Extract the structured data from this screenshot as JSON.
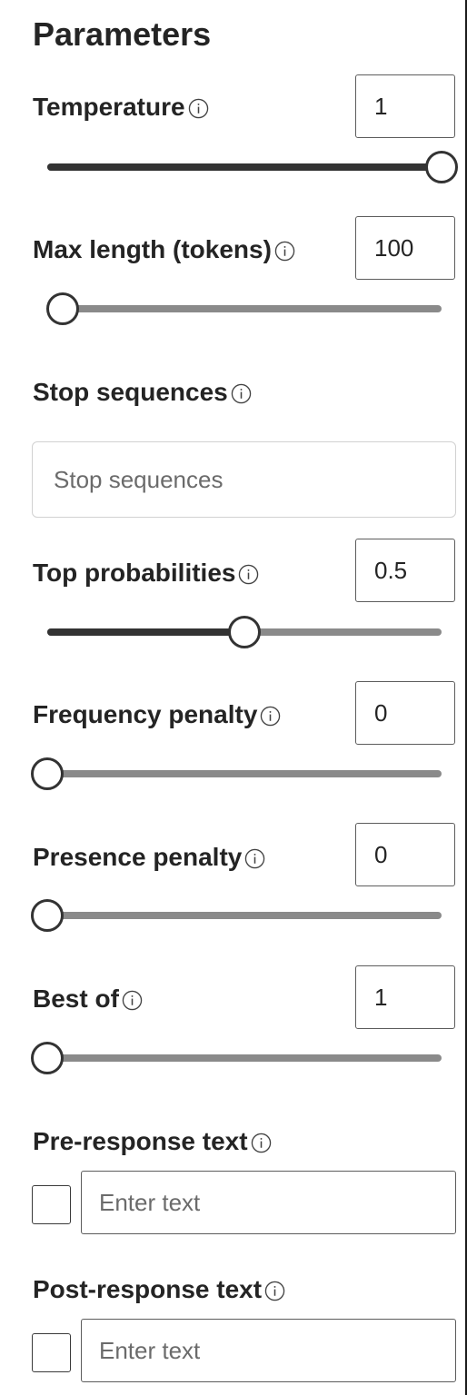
{
  "panel": {
    "title": "Parameters"
  },
  "icons": {
    "info": "info-icon"
  },
  "temperature": {
    "label": "Temperature",
    "value": "1",
    "slider_fraction": 1.0
  },
  "max_length": {
    "label": "Max length (tokens)",
    "value": "100",
    "slider_fraction": 0.04
  },
  "stop_sequences": {
    "label": "Stop sequences",
    "placeholder": "Stop sequences"
  },
  "top_probabilities": {
    "label": "Top probabilities",
    "value": "0.5",
    "slider_fraction": 0.5
  },
  "frequency_penalty": {
    "label": "Frequency penalty",
    "value": "0",
    "slider_fraction": 0.0
  },
  "presence_penalty": {
    "label": "Presence penalty",
    "value": "0",
    "slider_fraction": 0.0
  },
  "best_of": {
    "label": "Best of",
    "value": "1",
    "slider_fraction": 0.0
  },
  "pre_response": {
    "label": "Pre-response text",
    "placeholder": "Enter text",
    "checked": false
  },
  "post_response": {
    "label": "Post-response text",
    "placeholder": "Enter text",
    "checked": false
  }
}
